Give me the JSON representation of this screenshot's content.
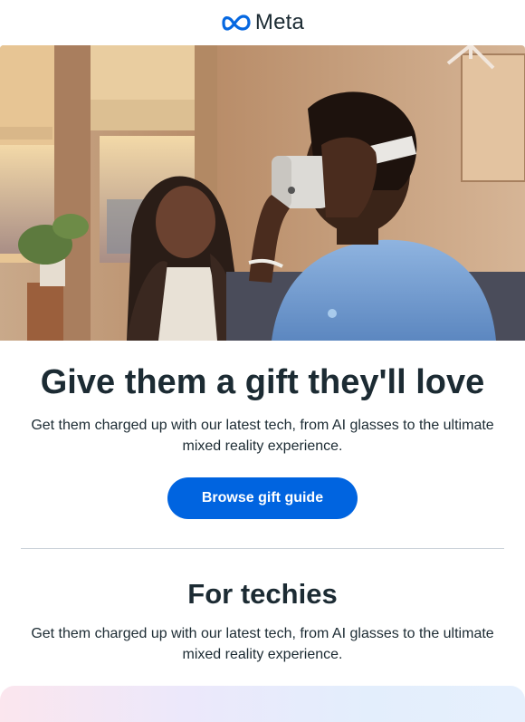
{
  "header": {
    "brand_name": "Meta",
    "logo_icon": "meta-infinity-logo-icon",
    "logo_color": "#0668E1"
  },
  "hero": {
    "image_description_icon": "hero-photo-vr-headset"
  },
  "main": {
    "headline": "Give them a gift they'll love",
    "subtext": "Get them charged up with our latest tech, from AI glasses to the ultimate mixed reality experience.",
    "cta_label": "Browse gift guide",
    "cta_color": "#0064E0"
  },
  "techies": {
    "title": "For techies",
    "subtext": "Get them charged up with our latest tech, from AI glasses to the ultimate mixed reality experience."
  }
}
